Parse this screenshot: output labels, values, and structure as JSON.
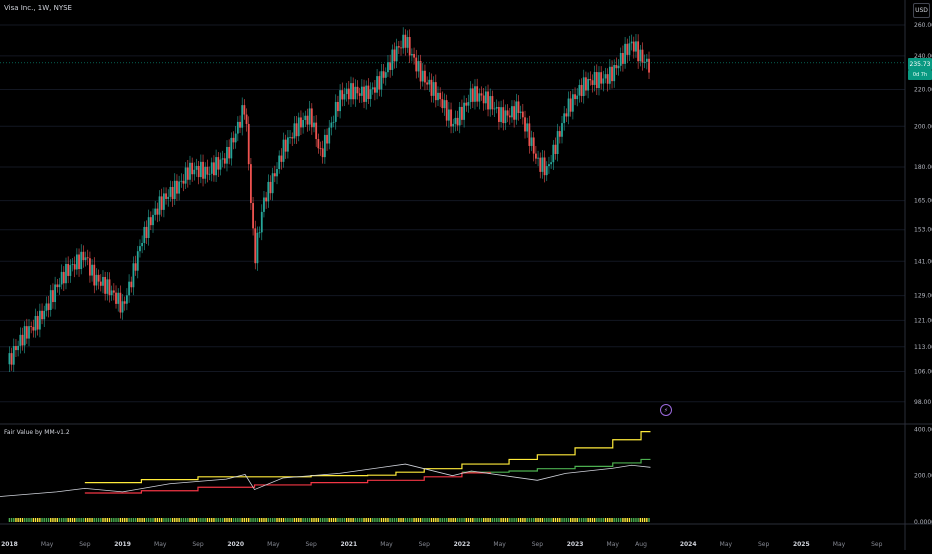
{
  "header": {
    "symbol_title": "Visa Inc., 1W, NYSE",
    "currency": "USD"
  },
  "price_axis": {
    "ticks": [
      "260.00",
      "240.00",
      "220.00",
      "200.00",
      "180.00",
      "165.00",
      "153.00",
      "141.00",
      "129.00",
      "121.00",
      "113.00",
      "106.00",
      "98.00"
    ],
    "last_price": "235.73",
    "last_price_sub": "0d 7h"
  },
  "indicator": {
    "title": "Fair Value by MM-v1.2",
    "ticks": [
      "400.00",
      "200.00",
      "0.0000"
    ]
  },
  "time_axis": {
    "labels": [
      "2018",
      "May",
      "Sep",
      "2019",
      "May",
      "Sep",
      "2020",
      "May",
      "Sep",
      "2021",
      "May",
      "Sep",
      "2022",
      "May",
      "Sep",
      "2023",
      "May",
      "Aug",
      "2024",
      "May",
      "Sep",
      "2025",
      "May",
      "Sep"
    ]
  },
  "colors": {
    "up": "#26a69a",
    "down": "#ef5350",
    "bg": "#000000",
    "fair_high": "#ffeb3b",
    "fair_mid": "#4caf50",
    "fair_low": "#f23645",
    "price_line": "#d1d4dc",
    "accent": "#089981"
  },
  "icons": {
    "flash": "lightning-icon"
  },
  "chart_data": [
    {
      "type": "candlestick",
      "title": "Visa Inc., 1W, NYSE",
      "scale": "log",
      "ylim": [
        93,
        262
      ],
      "x_range": [
        "2017-12",
        "2025-12"
      ],
      "price_anchors": [
        {
          "x": "2018-01",
          "y": 108
        },
        {
          "x": "2018-03",
          "y": 118
        },
        {
          "x": "2018-06",
          "y": 131
        },
        {
          "x": "2018-09",
          "y": 145
        },
        {
          "x": "2018-10",
          "y": 136
        },
        {
          "x": "2018-12",
          "y": 128
        },
        {
          "x": "2019-01",
          "y": 125
        },
        {
          "x": "2019-03",
          "y": 150
        },
        {
          "x": "2019-06",
          "y": 168
        },
        {
          "x": "2019-08",
          "y": 180
        },
        {
          "x": "2019-10",
          "y": 175
        },
        {
          "x": "2019-12",
          "y": 187
        },
        {
          "x": "2020-02",
          "y": 210
        },
        {
          "x": "2020-03",
          "y": 140
        },
        {
          "x": "2020-04",
          "y": 165
        },
        {
          "x": "2020-06",
          "y": 190
        },
        {
          "x": "2020-09",
          "y": 205
        },
        {
          "x": "2020-10",
          "y": 188
        },
        {
          "x": "2020-12",
          "y": 214
        },
        {
          "x": "2021-03",
          "y": 220
        },
        {
          "x": "2021-05",
          "y": 230
        },
        {
          "x": "2021-07",
          "y": 250
        },
        {
          "x": "2021-09",
          "y": 228
        },
        {
          "x": "2021-12",
          "y": 200
        },
        {
          "x": "2022-02",
          "y": 220
        },
        {
          "x": "2022-05",
          "y": 205
        },
        {
          "x": "2022-07",
          "y": 212
        },
        {
          "x": "2022-09",
          "y": 180
        },
        {
          "x": "2022-10",
          "y": 178
        },
        {
          "x": "2022-12",
          "y": 210
        },
        {
          "x": "2023-03",
          "y": 225
        },
        {
          "x": "2023-05",
          "y": 232
        },
        {
          "x": "2023-07",
          "y": 245
        },
        {
          "x": "2023-08",
          "y": 238
        },
        {
          "x": "2023-09",
          "y": 236
        }
      ]
    },
    {
      "type": "line",
      "title": "Fair Value by MM-v1.2",
      "ylim": [
        0,
        410
      ],
      "series": [
        {
          "color": "#ffeb3b",
          "points": [
            [
              "2018-09",
              170
            ],
            [
              "2019-03",
              183
            ],
            [
              "2019-09",
              195
            ],
            [
              "2020-03",
              195
            ],
            [
              "2020-09",
              200
            ],
            [
              "2021-03",
              202
            ],
            [
              "2021-06",
              215
            ],
            [
              "2021-09",
              230
            ],
            [
              "2022-01",
              250
            ],
            [
              "2022-06",
              270
            ],
            [
              "2022-09",
              290
            ],
            [
              "2023-01",
              320
            ],
            [
              "2023-05",
              355
            ],
            [
              "2023-08",
              390
            ],
            [
              "2023-09",
              390
            ]
          ]
        },
        {
          "color": "#4caf50",
          "points": [
            [
              "2022-01",
              215
            ],
            [
              "2022-06",
              220
            ],
            [
              "2022-09",
              230
            ],
            [
              "2023-01",
              240
            ],
            [
              "2023-05",
              255
            ],
            [
              "2023-08",
              270
            ],
            [
              "2023-09",
              270
            ]
          ]
        },
        {
          "color": "#f23645",
          "points": [
            [
              "2018-09",
              125
            ],
            [
              "2019-03",
              135
            ],
            [
              "2019-09",
              150
            ],
            [
              "2020-03",
              160
            ],
            [
              "2020-09",
              170
            ],
            [
              "2021-03",
              180
            ],
            [
              "2021-09",
              195
            ],
            [
              "2022-01",
              212
            ],
            [
              "2022-04",
              215
            ]
          ]
        },
        {
          "color": "#d1d4dc",
          "points": [
            [
              "2017-12",
              110
            ],
            [
              "2018-06",
              130
            ],
            [
              "2018-09",
              145
            ],
            [
              "2019-01",
              130
            ],
            [
              "2019-06",
              165
            ],
            [
              "2019-12",
              185
            ],
            [
              "2020-02",
              205
            ],
            [
              "2020-03",
              140
            ],
            [
              "2020-06",
              190
            ],
            [
              "2020-12",
              210
            ],
            [
              "2021-07",
              250
            ],
            [
              "2021-12",
              200
            ],
            [
              "2022-02",
              220
            ],
            [
              "2022-09",
              180
            ],
            [
              "2022-12",
              210
            ],
            [
              "2023-05",
              232
            ],
            [
              "2023-07",
              245
            ],
            [
              "2023-09",
              236
            ]
          ]
        }
      ]
    }
  ]
}
